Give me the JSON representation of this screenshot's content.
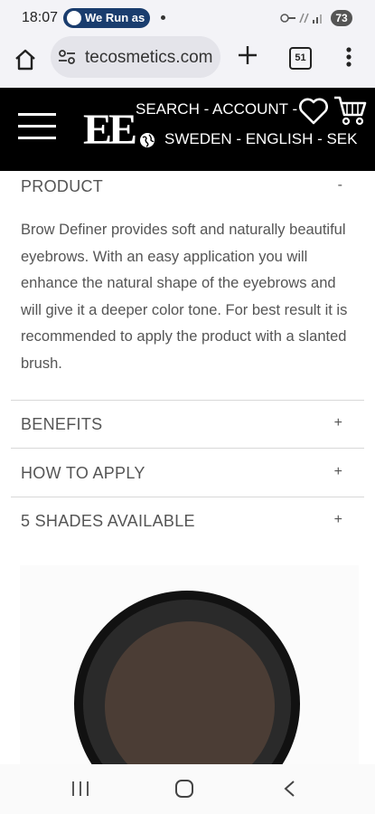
{
  "status": {
    "time": "18:07",
    "media_pill": "We Run as",
    "battery": "73"
  },
  "browser": {
    "url": "tecosmetics.com",
    "tab_count": "51"
  },
  "header": {
    "top_links": "SEARCH - ACCOUNT -",
    "bottom_links": "SWEDEN - ENGLISH - SEK"
  },
  "accordion": [
    {
      "title": "PRODUCT",
      "sign": "-"
    },
    {
      "title": "BENEFITS",
      "sign": "+"
    },
    {
      "title": "HOW TO APPLY",
      "sign": "+"
    },
    {
      "title": "5 SHADES AVAILABLE",
      "sign": "+"
    }
  ],
  "product_description": "Brow Definer provides soft and naturally beautiful eyebrows. With an easy application you will enhance the natural shape of the eyebrows and will give it a deeper color tone. For best result it is recommended to apply the product with a slanted brush.",
  "icons": {
    "home": "home-icon",
    "tune": "site-settings-icon",
    "new_tab": "plus-icon",
    "menu": "more-vertical-icon",
    "hamburger": "hamburger-menu-icon",
    "globe": "globe-icon",
    "wishlist": "heart-icon",
    "cart": "cart-icon"
  },
  "colors": {
    "header_bg": "#000000",
    "pill_bg": "#1a3d6e",
    "text": "#555555",
    "shade": "#4b3d35"
  }
}
